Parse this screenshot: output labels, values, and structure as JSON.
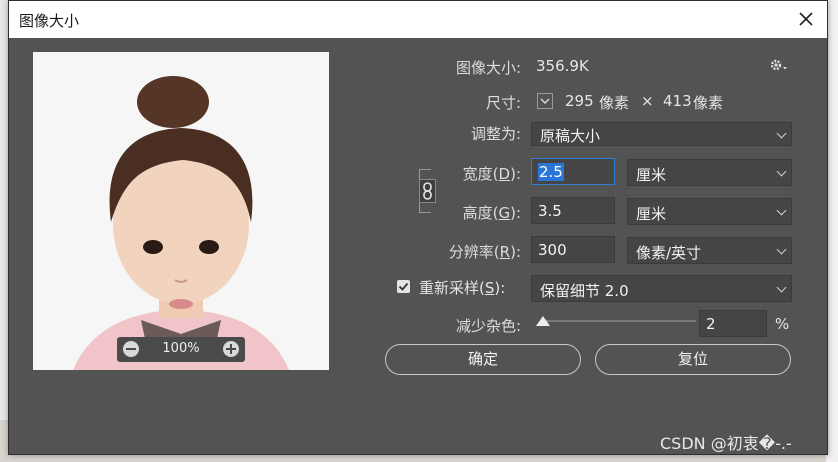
{
  "window": {
    "title": "图像大小"
  },
  "preview": {
    "zoom": "100%"
  },
  "image_size": {
    "label": "图像大小:",
    "value": "356.9K"
  },
  "dimensions": {
    "label": "尺寸:",
    "width": "295",
    "unit1": "像素",
    "times": "×",
    "height": "413",
    "unit2": "像素"
  },
  "fit_to": {
    "label": "调整为:",
    "value": "原稿大小"
  },
  "width": {
    "label_pre": "宽度(",
    "key": "D",
    "label_post": "):",
    "value": "2.5",
    "unit": "厘米"
  },
  "height": {
    "label_pre": "高度(",
    "key": "G",
    "label_post": "):",
    "value": "3.5",
    "unit": "厘米"
  },
  "resolution": {
    "label_pre": "分辨率(",
    "key": "R",
    "label_post": "):",
    "value": "300",
    "unit": "像素/英寸"
  },
  "resample": {
    "checked": true,
    "label_pre": "重新采样(",
    "key": "S",
    "label_post": "):",
    "value": "保留细节 2.0"
  },
  "noise": {
    "label": "减少杂色:",
    "value": "2",
    "unit": "%",
    "level_fraction": 0.0
  },
  "buttons": {
    "ok": "确定",
    "reset": "复位"
  },
  "watermark": "CSDN @初衷�-.-"
}
